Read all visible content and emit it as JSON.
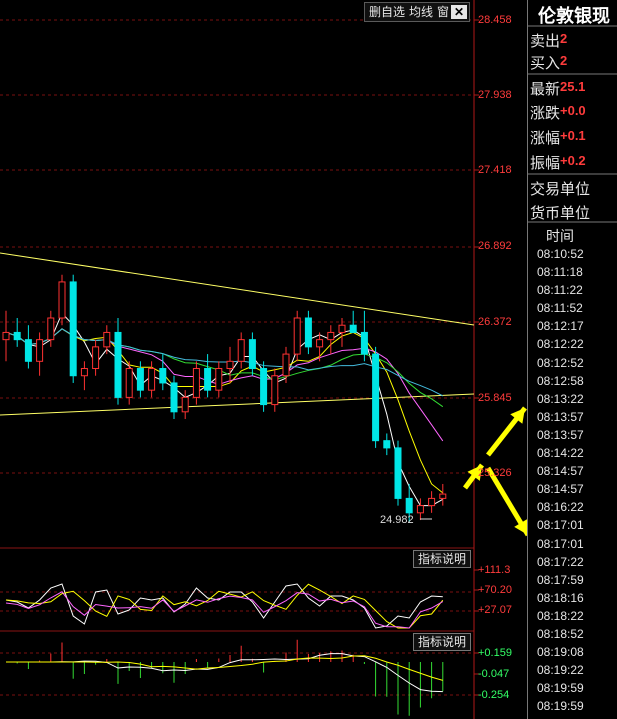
{
  "toolbar": {
    "delete_watch": "删自选",
    "ma_line": "均线",
    "window": "窗",
    "close_glyph": "✕"
  },
  "y_axis_labels": [
    "28.458",
    "27.938",
    "27.418",
    "26.892",
    "26.372",
    "25.845",
    "25.326"
  ],
  "low_annotation": "24.982",
  "indicator_explain_label": "指标说明",
  "macd_axis_labels": [
    "+111.3",
    "+70.20",
    "+27.07"
  ],
  "kdj_axis_labels": [
    "+0.159",
    "-0.047",
    "-0.254"
  ],
  "info_panel": {
    "title": "伦敦银现",
    "rows": [
      {
        "label": "卖出",
        "value": "2"
      },
      {
        "label": "买入",
        "value": "2"
      },
      {
        "label": "最新",
        "value": "25.1"
      },
      {
        "label": "涨跌",
        "value": "+0.0"
      },
      {
        "label": "涨幅",
        "value": "+0.1"
      },
      {
        "label": "振幅",
        "value": "+0.2"
      }
    ],
    "trade_unit": "交易单位",
    "currency_unit": "货币单位",
    "time_header": "时间"
  },
  "times": [
    "08:10:52",
    "08:11:18",
    "08:11:22",
    "08:11:52",
    "08:12:17",
    "08:12:22",
    "08:12:52",
    "08:12:58",
    "08:13:22",
    "08:13:57",
    "08:13:57",
    "08:14:22",
    "08:14:57",
    "08:14:57",
    "08:16:22",
    "08:17:01",
    "08:17:01",
    "08:17:22",
    "08:17:59",
    "08:18:16",
    "08:18:22",
    "08:18:52",
    "08:19:08",
    "08:19:22",
    "08:19:59",
    "08:19:59"
  ],
  "colors": {
    "up": "#ff3232",
    "down": "#00e6e6",
    "trendline": "#ffff66",
    "arrow": "#ffff00",
    "grid": "#7a1010"
  },
  "chart_data": {
    "type": "candlestick",
    "ylim": [
      24.8,
      28.5
    ],
    "candles": [
      [
        26.25,
        26.45,
        26.1,
        26.3
      ],
      [
        26.3,
        26.4,
        26.2,
        26.25
      ],
      [
        26.25,
        26.35,
        26.05,
        26.1
      ],
      [
        26.1,
        26.3,
        26.0,
        26.25
      ],
      [
        26.25,
        26.45,
        26.2,
        26.4
      ],
      [
        26.4,
        26.7,
        26.35,
        26.65
      ],
      [
        26.65,
        26.7,
        25.95,
        26.0
      ],
      [
        26.0,
        26.1,
        25.9,
        26.05
      ],
      [
        26.05,
        26.25,
        26.0,
        26.2
      ],
      [
        26.2,
        26.35,
        26.15,
        26.3
      ],
      [
        26.3,
        26.4,
        25.8,
        25.85
      ],
      [
        25.85,
        26.1,
        25.8,
        26.05
      ],
      [
        26.05,
        26.1,
        25.85,
        25.9
      ],
      [
        25.9,
        26.1,
        25.85,
        26.05
      ],
      [
        26.05,
        26.15,
        25.9,
        25.95
      ],
      [
        25.95,
        26.0,
        25.7,
        25.75
      ],
      [
        25.75,
        25.9,
        25.7,
        25.85
      ],
      [
        25.85,
        26.1,
        25.8,
        26.05
      ],
      [
        26.05,
        26.15,
        25.85,
        25.9
      ],
      [
        25.9,
        26.1,
        25.85,
        26.05
      ],
      [
        26.05,
        26.2,
        25.95,
        26.1
      ],
      [
        26.1,
        26.3,
        26.05,
        26.25
      ],
      [
        26.25,
        26.3,
        26.0,
        26.05
      ],
      [
        26.05,
        26.1,
        25.75,
        25.8
      ],
      [
        25.8,
        26.05,
        25.75,
        26.0
      ],
      [
        26.0,
        26.2,
        25.95,
        26.15
      ],
      [
        26.15,
        26.45,
        26.1,
        26.4
      ],
      [
        26.4,
        26.45,
        26.15,
        26.2
      ],
      [
        26.2,
        26.3,
        26.1,
        26.25
      ],
      [
        26.25,
        26.35,
        26.15,
        26.3
      ],
      [
        26.3,
        26.4,
        26.2,
        26.35
      ],
      [
        26.35,
        26.45,
        26.3,
        26.3
      ],
      [
        26.3,
        26.45,
        26.1,
        26.15
      ],
      [
        26.15,
        26.2,
        25.5,
        25.55
      ],
      [
        25.55,
        25.6,
        25.45,
        25.5
      ],
      [
        25.5,
        25.55,
        25.1,
        25.15
      ],
      [
        25.15,
        25.25,
        24.98,
        25.05
      ],
      [
        25.05,
        25.15,
        25.0,
        25.1
      ],
      [
        25.1,
        25.2,
        25.05,
        25.15
      ],
      [
        25.15,
        25.25,
        25.1,
        25.18
      ]
    ],
    "trendline_upper": [
      [
        0,
        26.72
      ],
      [
        39,
        26.36
      ]
    ],
    "trendline_lower": [
      [
        0,
        25.8
      ],
      [
        39,
        25.86
      ]
    ]
  }
}
